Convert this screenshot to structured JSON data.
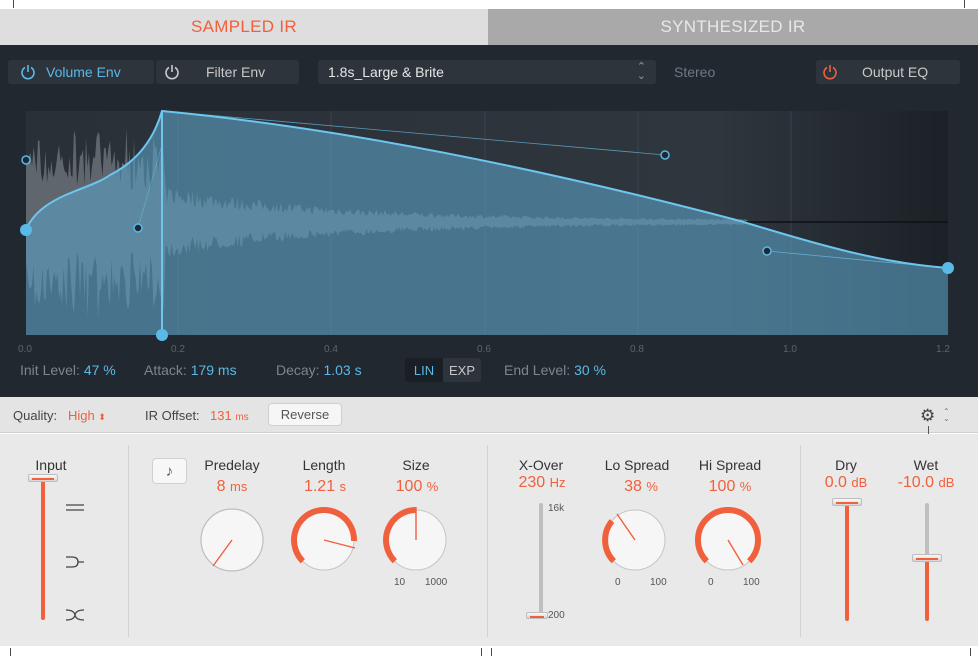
{
  "tabs": {
    "sampled": "SAMPLED IR",
    "synthesized": "SYNTHESIZED IR"
  },
  "toolbar": {
    "volume_env": "Volume Env",
    "filter_env": "Filter Env",
    "ir_preset": "1.8s_Large & Brite",
    "stereo": "Stereo",
    "output_eq": "Output EQ"
  },
  "envelope": {
    "time_ticks": [
      "0.0",
      "0.2",
      "0.4",
      "0.6",
      "0.8",
      "1.0",
      "1.2"
    ],
    "init_level_label": "Init Level:",
    "init_level": "47 %",
    "attack_label": "Attack:",
    "attack": "179 ms",
    "decay_label": "Decay:",
    "decay": "1.03 s",
    "lin": "LIN",
    "exp": "EXP",
    "end_level_label": "End Level:",
    "end_level": "30 %"
  },
  "quality_bar": {
    "quality_label": "Quality:",
    "quality": "High",
    "ir_offset_label": "IR Offset:",
    "ir_offset": "131",
    "ir_offset_unit": "ms",
    "reverse": "Reverse"
  },
  "controls": {
    "input": {
      "label": "Input"
    },
    "predelay": {
      "label": "Predelay",
      "value": "8",
      "unit": "ms"
    },
    "length": {
      "label": "Length",
      "value": "1.21",
      "unit": "s"
    },
    "size": {
      "label": "Size",
      "value": "100",
      "unit": "%",
      "min": "10",
      "max": "1000"
    },
    "xover": {
      "label": "X-Over",
      "value": "230",
      "unit": "Hz",
      "max": "16k",
      "min": "200"
    },
    "lo_spread": {
      "label": "Lo Spread",
      "value": "38",
      "unit": "%",
      "min": "0",
      "max": "100"
    },
    "hi_spread": {
      "label": "Hi Spread",
      "value": "100",
      "unit": "%",
      "min": "0",
      "max": "100"
    },
    "dry": {
      "label": "Dry",
      "value": "0.0",
      "unit": "dB"
    },
    "wet": {
      "label": "Wet",
      "value": "-10.0",
      "unit": "dB"
    }
  },
  "colors": {
    "accent_orange": "#f0603c",
    "accent_blue": "#5ab9e6",
    "panel_dark": "#22282f"
  }
}
